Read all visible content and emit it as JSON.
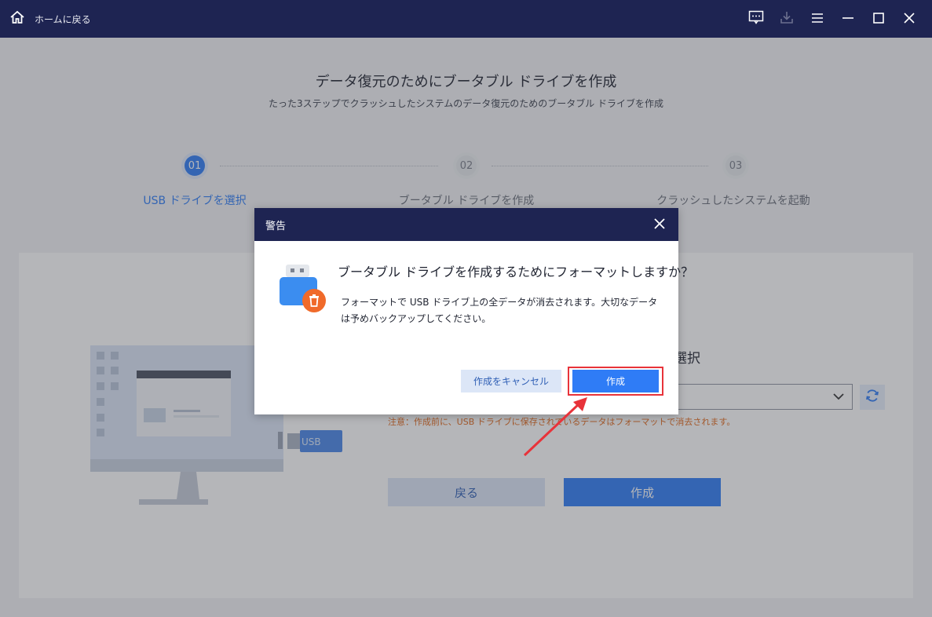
{
  "titlebar": {
    "home_label": "ホームに戻る",
    "icons": [
      "home-icon",
      "feedback-icon",
      "download-icon",
      "menu-icon",
      "minimize-icon",
      "maximize-icon",
      "close-icon"
    ]
  },
  "page": {
    "title": "データ復元のためにブータブル ドライブを作成",
    "subtitle": "たった3ステップでクラッシュしたシステムのデータ復元のためのブータブル ドライブを作成"
  },
  "steps": [
    {
      "number": "01",
      "label": "USB ドライブを選択",
      "active": true
    },
    {
      "number": "02",
      "label": "ブータブル ドライブを作成",
      "active": false
    },
    {
      "number": "03",
      "label": "クラッシュしたシステムを起動",
      "active": false
    }
  ],
  "main": {
    "select_title": "選択",
    "select_value": "",
    "note": "注意：作成前に、USB ドライブに保存されているデータはフォーマットで消去されます。",
    "back_label": "戻る",
    "create_label": "作成",
    "usb_text": "USB"
  },
  "dialog": {
    "title": "警告",
    "question": "ブータブル ドライブを作成するためにフォーマットしますか？",
    "message": "フォーマットで USB ドライブ上の全データが消去されます。大切なデータは予めバックアップしてください。",
    "cancel_label": "作成をキャンセル",
    "create_label": "作成"
  },
  "colors": {
    "titlebar": "#1e2452",
    "accent": "#2f7cf6",
    "highlight": "#e8333a",
    "note": "#e26a1d"
  }
}
